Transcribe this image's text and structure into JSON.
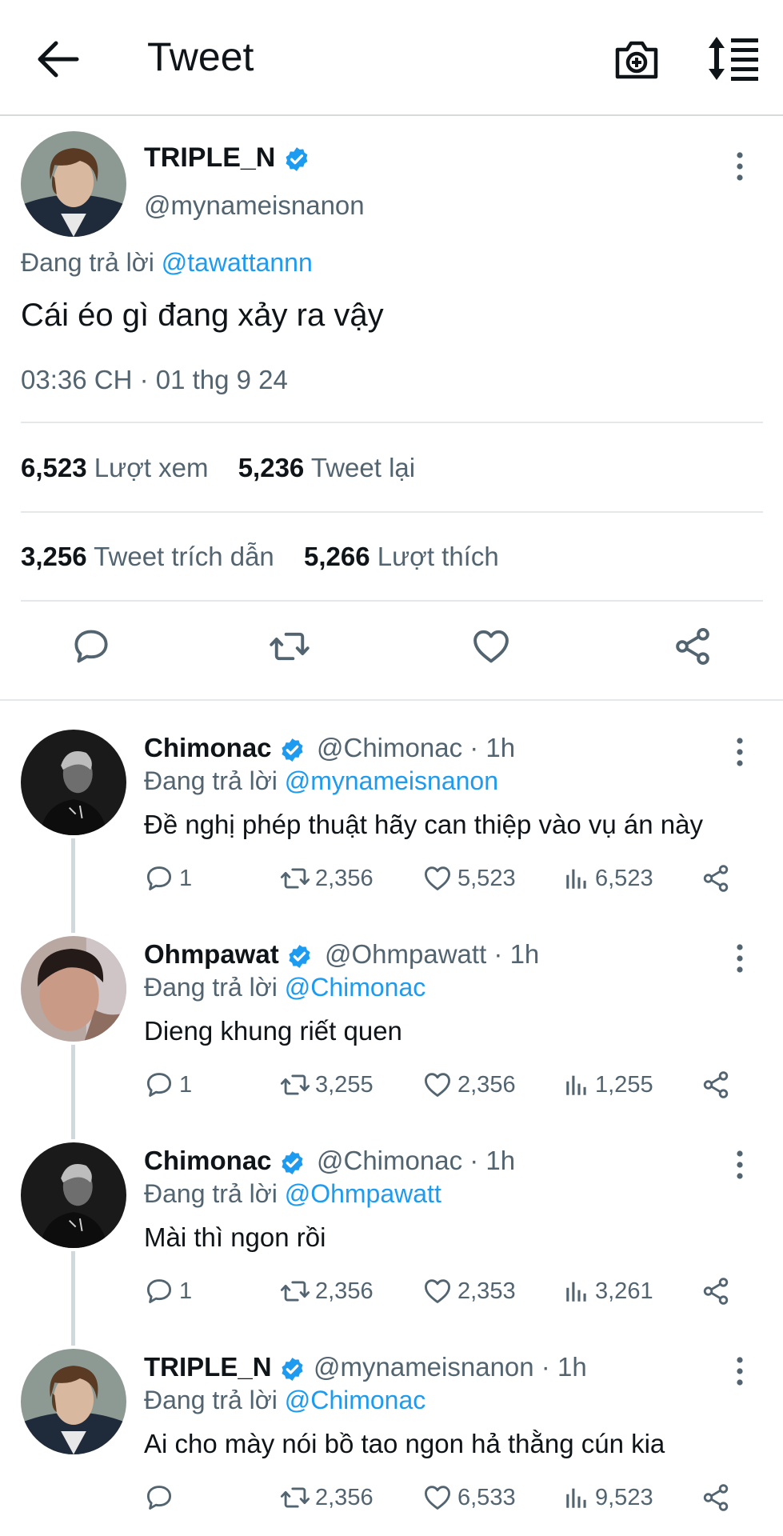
{
  "header": {
    "title": "Tweet"
  },
  "main_tweet": {
    "display_name": "TRIPLE_N",
    "handle": "@mynameisnanon",
    "reply_prefix": "Đang trả lời",
    "reply_to": "@tawattannn",
    "text": "Cái éo gì đang xảy ra vậy",
    "timestamp": "03:36 CH · 01 thg 9 24",
    "stats": {
      "views_count": "6,523",
      "views_label": "Lượt xem",
      "retweets_count": "5,236",
      "retweets_label": "Tweet lại",
      "quotes_count": "3,256",
      "quotes_label": "Tweet trích dẫn",
      "likes_count": "5,266",
      "likes_label": "Lượt thích"
    }
  },
  "replies": [
    {
      "display_name": "Chimonac",
      "handle": "@Chimonac · 1h",
      "reply_prefix": "Đang trả lời",
      "reply_to": "@mynameisnanon",
      "text": "Đề nghị phép thuật hãy can thiệp vào vụ án này",
      "replies": "1",
      "retweets": "2,356",
      "likes": "5,523",
      "views": "6,523"
    },
    {
      "display_name": "Ohmpawat",
      "handle": "@Ohmpawatt · 1h",
      "reply_prefix": "Đang trả lời",
      "reply_to": "@Chimonac",
      "text": "Dieng khung riết quen",
      "replies": "1",
      "retweets": "3,255",
      "likes": "2,356",
      "views": "1,255"
    },
    {
      "display_name": "Chimonac",
      "handle": "@Chimonac · 1h",
      "reply_prefix": "Đang trả lời",
      "reply_to": "@Ohmpawatt",
      "text": "Mài thì ngon rồi",
      "replies": "1",
      "retweets": "2,356",
      "likes": "2,353",
      "views": "3,261"
    },
    {
      "display_name": "TRIPLE_N",
      "handle": "@mynameisnanon · 1h",
      "reply_prefix": "Đang trả lời",
      "reply_to": "@Chimonac",
      "text": "Ai cho mày nói bồ tao ngon hả thằng cún kia",
      "replies": "",
      "retweets": "2,356",
      "likes": "6,533",
      "views": "9,523"
    }
  ],
  "colors": {
    "accent": "#1d9bf0",
    "muted": "#536471",
    "text": "#0f1419",
    "divider": "#e5e8eb"
  },
  "icons": [
    "back-arrow-icon",
    "camera-plus-icon",
    "sort-list-icon",
    "more-vertical-icon",
    "verified-badge-icon",
    "reply-icon",
    "retweet-icon",
    "like-icon",
    "share-icon",
    "views-icon"
  ]
}
